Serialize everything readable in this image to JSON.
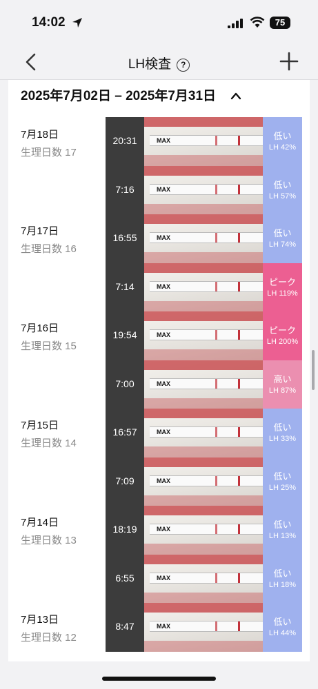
{
  "status": {
    "time": "14:02",
    "battery": "75"
  },
  "header": {
    "title": "LH検査",
    "help_icon": "?"
  },
  "range": {
    "label": "2025年7月02日 – 2025年7月31日"
  },
  "days": [
    {
      "date": "7月18日",
      "cycle": "生理日数 17"
    },
    {
      "date": "7月17日",
      "cycle": "生理日数 16"
    },
    {
      "date": "7月16日",
      "cycle": "生理日数 15"
    },
    {
      "date": "7月15日",
      "cycle": "生理日数 14"
    },
    {
      "date": "7月14日",
      "cycle": "生理日数 13"
    },
    {
      "date": "7月13日",
      "cycle": "生理日数 12"
    }
  ],
  "tests": [
    {
      "time": "20:31",
      "level": "低い",
      "lh": "LH 42%"
    },
    {
      "time": "7:16",
      "level": "低い",
      "lh": "LH 57%"
    },
    {
      "time": "16:55",
      "level": "低い",
      "lh": "LH 74%"
    },
    {
      "time": "7:14",
      "level": "ピーク",
      "lh": "LH 119%"
    },
    {
      "time": "19:54",
      "level": "ピーク",
      "lh": "LH 200%"
    },
    {
      "time": "7:00",
      "level": "高い",
      "lh": "LH 87%"
    },
    {
      "time": "16:57",
      "level": "低い",
      "lh": "LH 33%"
    },
    {
      "time": "7:09",
      "level": "低い",
      "lh": "LH 25%"
    },
    {
      "time": "18:19",
      "level": "低い",
      "lh": "LH 13%"
    },
    {
      "time": "6:55",
      "level": "低い",
      "lh": "LH 18%"
    },
    {
      "time": "8:47",
      "level": "低い",
      "lh": "LH 44%"
    }
  ],
  "strip_label": "MAX",
  "colors": {
    "low": "#9fb1ee",
    "peak": "#ec5f92",
    "high": "#eb8fb0"
  }
}
